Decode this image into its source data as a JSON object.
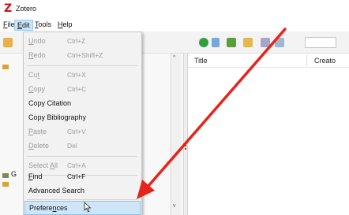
{
  "app": {
    "logo": "Z",
    "title": "Zotero"
  },
  "menubar": {
    "items": [
      {
        "pre": "",
        "key": "F",
        "post": "ile"
      },
      {
        "pre": "",
        "key": "E",
        "post": "dit"
      },
      {
        "pre": "",
        "key": "T",
        "post": "ools"
      },
      {
        "pre": "",
        "key": "H",
        "post": "elp"
      }
    ]
  },
  "edit_menu": {
    "undo": {
      "pre": "",
      "key": "U",
      "post": "ndo",
      "shortcut": "Ctrl+Z"
    },
    "redo": {
      "pre": "",
      "key": "R",
      "post": "edo",
      "shortcut": "Ctrl+Shift+Z"
    },
    "cut": {
      "pre": "Cu",
      "key": "t",
      "post": "",
      "shortcut": "Ctrl+X"
    },
    "copy": {
      "pre": "",
      "key": "C",
      "post": "opy",
      "shortcut": "Ctrl+C"
    },
    "copy_citation": {
      "label": "Copy Citation"
    },
    "copy_bibliography": {
      "label": "Copy Bibliography"
    },
    "paste": {
      "pre": "",
      "key": "P",
      "post": "aste",
      "shortcut": "Ctrl+V"
    },
    "delete": {
      "pre": "",
      "key": "D",
      "post": "elete",
      "shortcut": "Del"
    },
    "select_all": {
      "pre": "Select ",
      "key": "A",
      "post": "ll",
      "shortcut": "Ctrl+A"
    },
    "find": {
      "pre": "",
      "key": "F",
      "post": "ind",
      "shortcut": "Ctrl+F"
    },
    "advanced_search": {
      "label": "Advanced Search"
    },
    "preferences": {
      "pre": "Prefere",
      "key": "n",
      "post": "ces"
    }
  },
  "items_pane": {
    "columns": [
      "Title",
      "Creato"
    ]
  },
  "left_pane": {
    "group_label_fragment": "G"
  },
  "colors": {
    "accent": "#cfe5f8",
    "arrow": "#e8231c",
    "logo": "#c4161c"
  }
}
